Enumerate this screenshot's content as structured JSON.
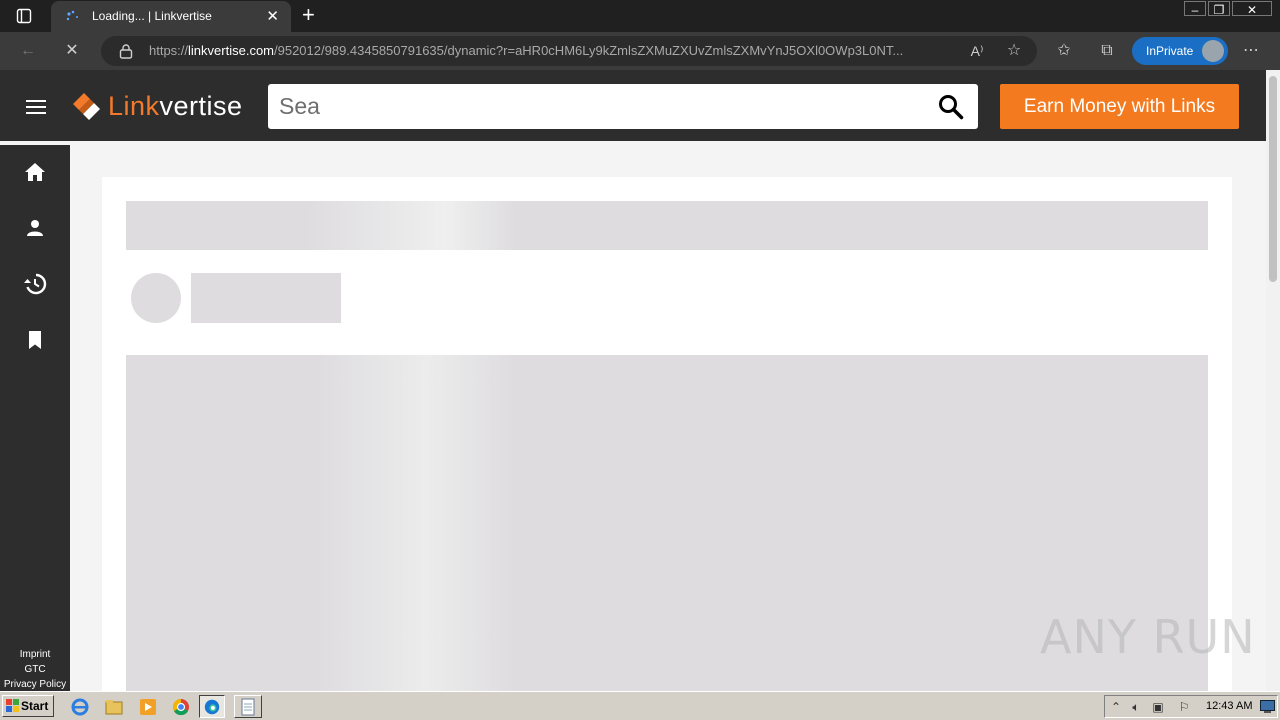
{
  "browser": {
    "tab_title": "Loading... | Linkvertise",
    "url_prefix": "https://",
    "url_host": "linkvertise.com",
    "url_rest": "/952012/989.4345850791635/dynamic?r=aHR0cHM6Ly9kZmlsZXMuZXUvZmlsZXMvYnJ5OXl0OWp3L0NT...",
    "inprivate_label": "InPrivate"
  },
  "site": {
    "logo_brand_part": "Link",
    "logo_rest_part": "vertise",
    "search_value": "Sea",
    "earn_button": "Earn Money with Links",
    "footer_links": [
      "Imprint",
      "GTC",
      "Privacy Policy"
    ]
  },
  "nav_icons": [
    "home-icon",
    "profile-icon",
    "history-icon",
    "bookmark-icon"
  ],
  "watermark": "ANY RUN",
  "taskbar": {
    "start_label": "Start",
    "clock": "12:43 AM"
  },
  "colors": {
    "brand_orange": "#f37a1f",
    "header_dark": "#2d2d2d",
    "skeleton": "#dedcdf",
    "inprivate_blue": "#1a6fc4"
  }
}
